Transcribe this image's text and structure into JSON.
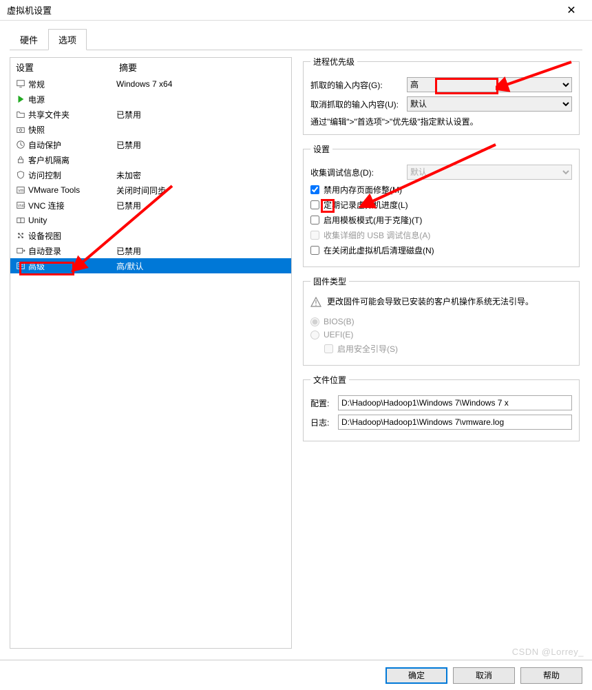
{
  "title": "虚拟机设置",
  "tabs": {
    "hardware": "硬件",
    "options": "选项"
  },
  "left": {
    "header_setting": "设置",
    "header_summary": "摘要",
    "items": [
      {
        "name": "常规",
        "summary": "Windows 7 x64",
        "icon": "monitor"
      },
      {
        "name": "电源",
        "summary": "",
        "icon": "play"
      },
      {
        "name": "共享文件夹",
        "summary": "已禁用",
        "icon": "folder"
      },
      {
        "name": "快照",
        "summary": "",
        "icon": "camera"
      },
      {
        "name": "自动保护",
        "summary": "已禁用",
        "icon": "clock"
      },
      {
        "name": "客户机隔离",
        "summary": "",
        "icon": "lock"
      },
      {
        "name": "访问控制",
        "summary": "未加密",
        "icon": "shield"
      },
      {
        "name": "VMware Tools",
        "summary": "关闭时间同步",
        "icon": "vmw"
      },
      {
        "name": "VNC 连接",
        "summary": "已禁用",
        "icon": "vnc"
      },
      {
        "name": "Unity",
        "summary": "",
        "icon": "unity"
      },
      {
        "name": "设备视图",
        "summary": "",
        "icon": "device"
      },
      {
        "name": "自动登录",
        "summary": "已禁用",
        "icon": "login"
      },
      {
        "name": "高级",
        "summary": "高/默认",
        "icon": "adv"
      }
    ]
  },
  "right": {
    "priority_legend": "进程优先级",
    "grabbed_label": "抓取的输入内容(G):",
    "grabbed_value": "高",
    "ungrabbed_label": "取消抓取的输入内容(U):",
    "ungrabbed_value": "默认",
    "priority_hint": "通过\"编辑\">\"首选项\">\"优先级\"指定默认设置。",
    "settings_legend": "设置",
    "debug_label": "收集调试信息(D):",
    "debug_value": "默认",
    "cb_mem": "禁用内存页面修整(M)",
    "cb_log": "定期记录虚拟机进度(L)",
    "cb_template": "启用模板模式(用于克隆)(T)",
    "cb_usb": "收集详细的 USB 调试信息(A)",
    "cb_clean": "在关闭此虚拟机后清理磁盘(N)",
    "firmware_legend": "固件类型",
    "firmware_warn": "更改固件可能会导致已安装的客户机操作系统无法引导。",
    "bios": "BIOS(B)",
    "uefi": "UEFI(E)",
    "secureboot": "启用安全引导(S)",
    "fileloc_legend": "文件位置",
    "config_label": "配置:",
    "config_value": "D:\\Hadoop\\Hadoop1\\Windows 7\\Windows 7 x",
    "log_label": "日志:",
    "log_value": "D:\\Hadoop\\Hadoop1\\Windows 7\\vmware.log"
  },
  "buttons": {
    "ok": "确定",
    "cancel": "取消",
    "help": "帮助"
  },
  "watermark": "CSDN @Lorrey_"
}
